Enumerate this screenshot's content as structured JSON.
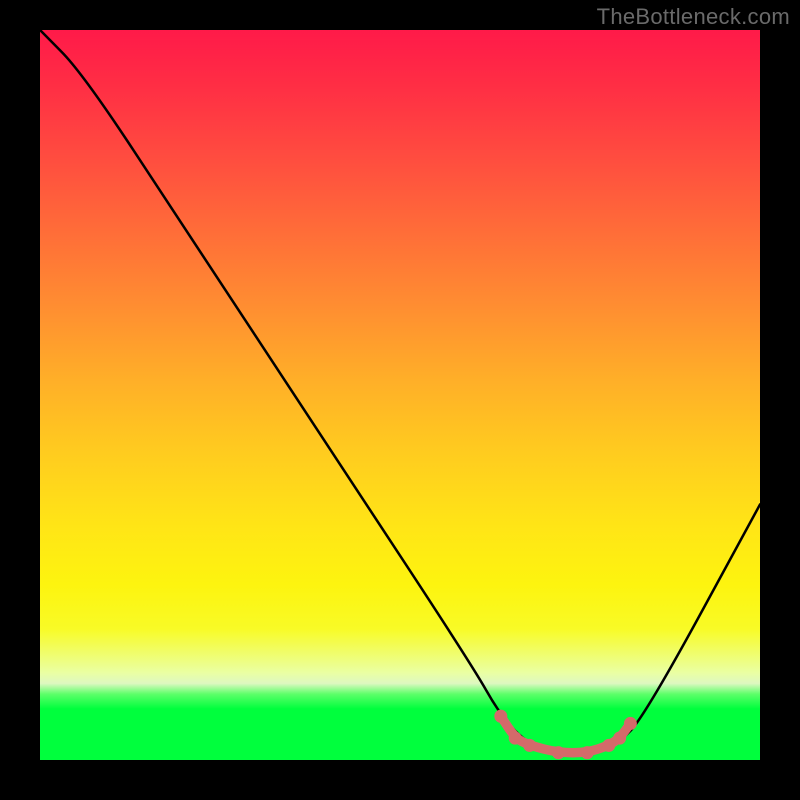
{
  "watermark": "TheBottleneck.com",
  "chart_data": {
    "type": "line",
    "title": "",
    "xlabel": "",
    "ylabel": "",
    "xlim": [
      0,
      100
    ],
    "ylim": [
      0,
      100
    ],
    "series": [
      {
        "name": "bottleneck-curve",
        "x": [
          0,
          6,
          20,
          40,
          60,
          64,
          68,
          72,
          76,
          80,
          84,
          100
        ],
        "y": [
          100,
          94,
          73,
          43,
          13,
          6,
          2,
          1,
          1,
          2,
          6,
          35
        ],
        "color": "#000000"
      }
    ],
    "highlight": {
      "name": "optimal-range",
      "color": "#d46a6a",
      "x": [
        64,
        66,
        68,
        72,
        76,
        79,
        80.5,
        82
      ],
      "y": [
        6,
        3,
        2,
        1,
        1,
        2,
        3,
        5
      ]
    },
    "gradient_stops": [
      {
        "pos": 0,
        "color": "#ff1a49"
      },
      {
        "pos": 8,
        "color": "#ff2f44"
      },
      {
        "pos": 18,
        "color": "#ff4e3f"
      },
      {
        "pos": 28,
        "color": "#ff6e38"
      },
      {
        "pos": 38,
        "color": "#ff8e31"
      },
      {
        "pos": 48,
        "color": "#ffaf28"
      },
      {
        "pos": 58,
        "color": "#ffcc1f"
      },
      {
        "pos": 68,
        "color": "#ffe516"
      },
      {
        "pos": 76,
        "color": "#fdf40f"
      },
      {
        "pos": 82,
        "color": "#f8fb26"
      },
      {
        "pos": 88,
        "color": "#eaffa2"
      },
      {
        "pos": 91,
        "color": "#5bff68"
      },
      {
        "pos": 93,
        "color": "#00ff3d"
      },
      {
        "pos": 100,
        "color": "#00ff3d"
      }
    ]
  }
}
